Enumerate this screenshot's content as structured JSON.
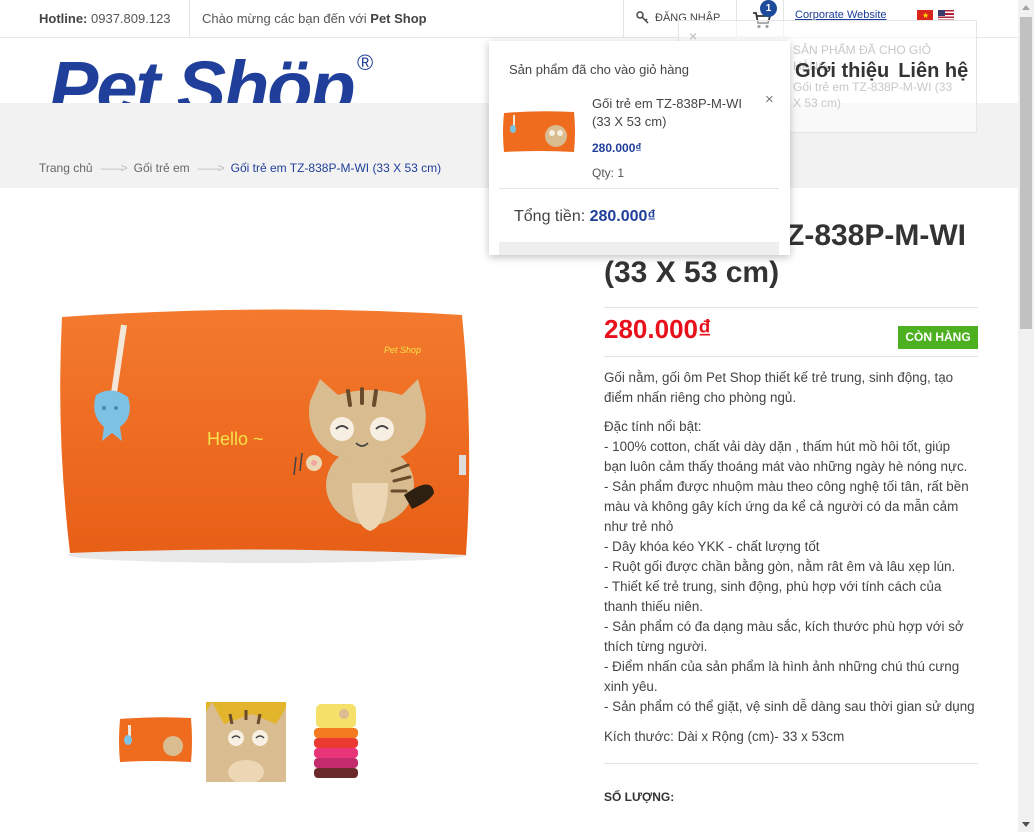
{
  "topbar": {
    "hotline_label": "Hotline:",
    "hotline_number": "0937.809.123",
    "welcome_text": "Chào mừng các bạn đến với",
    "welcome_brand": "Pet Shop",
    "login_label": "ĐĂNG NHẬP",
    "cart_count": "1",
    "corporate_link": "Corporate Website"
  },
  "header": {
    "logo_text": "Pet Shöp",
    "logo_registered": "®",
    "nav_items": [
      "Giới thiệu",
      "Liên hệ"
    ]
  },
  "breadcrumb": {
    "items": [
      "Trang chủ",
      "Gối trẻ em"
    ],
    "current": "Gối trẻ em TZ-838P-M-WI (33 X 53 cm)",
    "separator": "——>"
  },
  "ghost_toast": {
    "title": "SẢN PHẨM ĐÃ CHO GIỎ HÀNG",
    "desc": "Gối trẻ em TZ-838P-M-WI (33 X 53 cm)",
    "close": "×"
  },
  "cart_popup": {
    "title": "Sản phẩm đã cho vào giỏ hàng",
    "close": "×",
    "item_name": "Gối trẻ em TZ-838P-M-WI (33 X 53 cm)",
    "item_price": "280.000₫",
    "item_qty": "Qty: 1",
    "total_label": "Tổng tiền:",
    "total_value": "280.000₫"
  },
  "product": {
    "title_line1": "Z-838P-M-WI",
    "title_line2": "(33 X 53 cm)",
    "price": "280.000₫",
    "stock_status": "CÒN HÀNG",
    "intro_lines": [
      "Gối nằm, gối ôm Pet Shop thiết kế trẻ trung, sinh động, tạo",
      "điểm nhấn riêng cho phòng ngủ."
    ],
    "features_lines": [
      "Đặc tính nổi bật:",
      "- 100% cotton, chất vải dày dặn , thấm hút mồ hôi tốt, giúp",
      "bạn luôn cảm thấy thoáng mát vào những ngày hè nóng nực.",
      "- Sản phẩm được nhuộm màu theo công nghệ tối tân, rất bền",
      "màu và không gây kích ứng da kể cả người có da mẫn cảm",
      "như trẻ nhỏ",
      "- Dây khóa kéo YKK - chất lượng tốt",
      "- Ruột gối được chần bằng gòn, nằm rât êm và lâu xẹp lún.",
      "- Thiết kế trẻ trung, sinh động, phù hợp với tính cách của",
      "thanh thiếu niên.",
      "- Sản phẩm có đa dạng màu sắc, kích thước phù hợp với sở",
      "thích từng người.",
      "- Điểm nhấn của sản phẩm là hình ảnh những chú thú cưng",
      "xinh yêu.",
      "- Sản phẩm có thể giặt, vệ sinh dễ dàng sau thời gian sử dụng"
    ],
    "size_line": "Kích thước: Dài x Rộng (cm)- 33 x 53cm",
    "quantity_label": "SỐ LƯỢNG:",
    "pillow_brand": "Pet Shop",
    "pillow_text": "Hello ~"
  },
  "colors": {
    "brand_blue": "#1f3f9a",
    "price_red": "#e8111b",
    "stock_green": "#4db020",
    "pillow_orange": "#f06a1e"
  }
}
